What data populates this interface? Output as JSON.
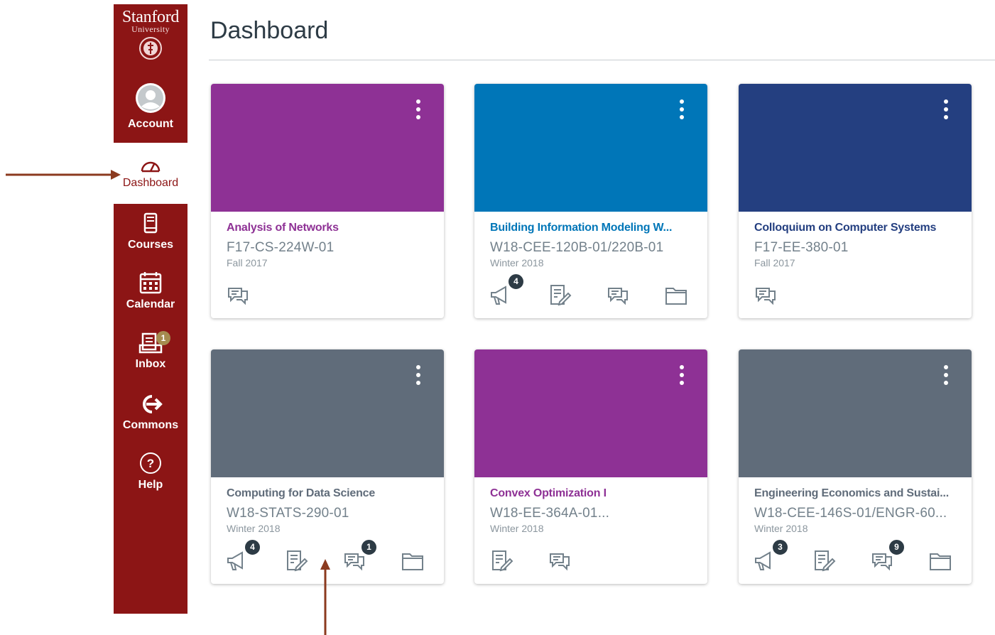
{
  "sidebar": {
    "logo_name": "Stanford",
    "logo_sub": "University",
    "items": [
      {
        "label": "Account"
      },
      {
        "label": "Dashboard"
      },
      {
        "label": "Courses"
      },
      {
        "label": "Calendar"
      },
      {
        "label": "Inbox",
        "badge": "1"
      },
      {
        "label": "Commons"
      },
      {
        "label": "Help"
      }
    ]
  },
  "page": {
    "title": "Dashboard"
  },
  "colors": {
    "sidebar": "#8c1515",
    "purple": "#8e3195",
    "blue": "#0076b8",
    "navy": "#243f80",
    "gray": "#606c7a"
  },
  "cards": [
    {
      "title": "Analysis of Networks",
      "code": "F17-CS-224W-01",
      "term": "Fall 2017",
      "color": "#8e3195",
      "title_color": "#8e3195",
      "icons": [
        {
          "name": "discussions-icon",
          "badge": ""
        }
      ]
    },
    {
      "title": "Building Information Modeling W...",
      "code": "W18-CEE-120B-01/220B-01",
      "term": "Winter 2018",
      "color": "#0076b8",
      "title_color": "#0076b8",
      "icons": [
        {
          "name": "announcements-icon",
          "badge": "4"
        },
        {
          "name": "assignments-icon",
          "badge": ""
        },
        {
          "name": "discussions-icon",
          "badge": ""
        },
        {
          "name": "files-icon",
          "badge": ""
        }
      ]
    },
    {
      "title": "Colloquium on Computer Systems",
      "code": "F17-EE-380-01",
      "term": "Fall 2017",
      "color": "#243f80",
      "title_color": "#243f80",
      "icons": [
        {
          "name": "discussions-icon",
          "badge": ""
        }
      ]
    },
    {
      "title": "Computing for Data Science",
      "code": "W18-STATS-290-01",
      "term": "Winter 2018",
      "color": "#606c7a",
      "title_color": "#606c7a",
      "icons": [
        {
          "name": "announcements-icon",
          "badge": "4"
        },
        {
          "name": "assignments-icon",
          "badge": ""
        },
        {
          "name": "discussions-icon",
          "badge": "1"
        },
        {
          "name": "files-icon",
          "badge": ""
        }
      ]
    },
    {
      "title": "Convex Optimization I",
      "code": "W18-EE-364A-01...",
      "term": "Winter 2018",
      "color": "#8e3195",
      "title_color": "#8e3195",
      "icons": [
        {
          "name": "assignments-icon",
          "badge": ""
        },
        {
          "name": "discussions-icon",
          "badge": ""
        }
      ]
    },
    {
      "title": "Engineering Economics and Sustai...",
      "code": "W18-CEE-146S-01/ENGR-60...",
      "term": "Winter 2018",
      "color": "#606c7a",
      "title_color": "#606c7a",
      "icons": [
        {
          "name": "announcements-icon",
          "badge": "3"
        },
        {
          "name": "assignments-icon",
          "badge": ""
        },
        {
          "name": "discussions-icon",
          "badge": "9"
        },
        {
          "name": "files-icon",
          "badge": ""
        }
      ]
    }
  ]
}
